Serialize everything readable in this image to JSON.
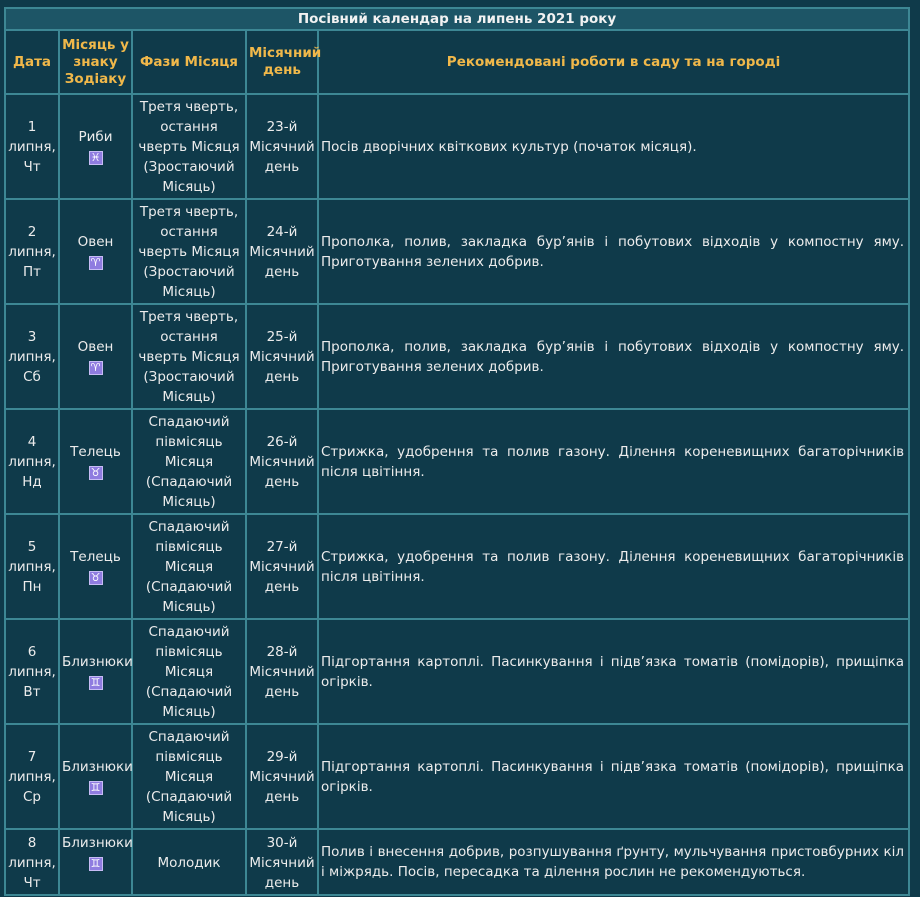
{
  "title": "Посівний календар на липень 2021 року",
  "headers": {
    "date": "Дата",
    "zodiac": "Місяць у знаку Зодіаку",
    "phase": "Фази Місяця",
    "lunar_day": "Місячний день",
    "works": "Рекомендовані роботи в саду та на городі"
  },
  "rows": [
    {
      "day": "1",
      "month": "липня,",
      "weekday": "Чт",
      "zodiac": "Риби",
      "zodiac_symbol": "♓",
      "phase": "Третя чверть, остання чверть Місяця (Зростаючий Місяць)",
      "lunar_day": "23-й Місячний день",
      "works": "Посів дворічних квіткових культур (початок місяця)."
    },
    {
      "day": "2",
      "month": "липня,",
      "weekday": "Пт",
      "zodiac": "Овен",
      "zodiac_symbol": "♈",
      "phase": "Третя чверть, остання чверть Місяця (Зростаючий Місяць)",
      "lunar_day": "24-й Місячний день",
      "works": "Прополка, полив, закладка бур’янів і побутових відходів у компостну яму. Приготування зелених добрив."
    },
    {
      "day": "3",
      "month": "липня,",
      "weekday": "Сб",
      "zodiac": "Овен",
      "zodiac_symbol": "♈",
      "phase": "Третя чверть, остання чверть Місяця (Зростаючий Місяць)",
      "lunar_day": "25-й Місячний день",
      "works": "Прополка, полив, закладка бур’янів і побутових відходів у компостну яму. Приготування зелених добрив."
    },
    {
      "day": "4",
      "month": "липня,",
      "weekday": "Нд",
      "zodiac": "Телець",
      "zodiac_symbol": "♉",
      "phase": "Спадаючий півмісяць Місяця (Спадаючий Місяць)",
      "lunar_day": "26-й Місячний день",
      "works": "Стрижка, удобрення та полив газону. Ділення кореневищних багаторічників після цвітіння."
    },
    {
      "day": "5",
      "month": "липня,",
      "weekday": "Пн",
      "zodiac": "Телець",
      "zodiac_symbol": "♉",
      "phase": "Спадаючий півмісяць Місяця (Спадаючий Місяць)",
      "lunar_day": "27-й Місячний день",
      "works": "Стрижка, удобрення та полив газону. Ділення кореневищних багаторічників після цвітіння."
    },
    {
      "day": "6",
      "month": "липня,",
      "weekday": "Вт",
      "zodiac": "Близнюки",
      "zodiac_symbol": "♊",
      "phase": "Спадаючий півмісяць Місяця (Спадаючий Місяць)",
      "lunar_day": "28-й Місячний день",
      "works": "Підгортання картоплі. Пасинкування і підв’язка томатів (помідорів), прищіпка огірків."
    },
    {
      "day": "7",
      "month": "липня,",
      "weekday": "Ср",
      "zodiac": "Близнюки",
      "zodiac_symbol": "♊",
      "phase": "Спадаючий півмісяць Місяця (Спадаючий Місяць)",
      "lunar_day": "29-й Місячний день",
      "works": "Підгортання картоплі. Пасинкування і підв’язка томатів (помідорів), прищіпка огірків."
    },
    {
      "day": "8",
      "month": "липня,",
      "weekday": "Чт",
      "zodiac": "Близнюки",
      "zodiac_symbol": "♊",
      "phase": "Молодик",
      "lunar_day": "30-й Місячний день",
      "works": "Полив і внесення добрив, розпушування ґрунту, мульчування пристовбурних кіл і міжрядь. Посів, пересадка та ділення рослин не рекомендуються."
    }
  ]
}
